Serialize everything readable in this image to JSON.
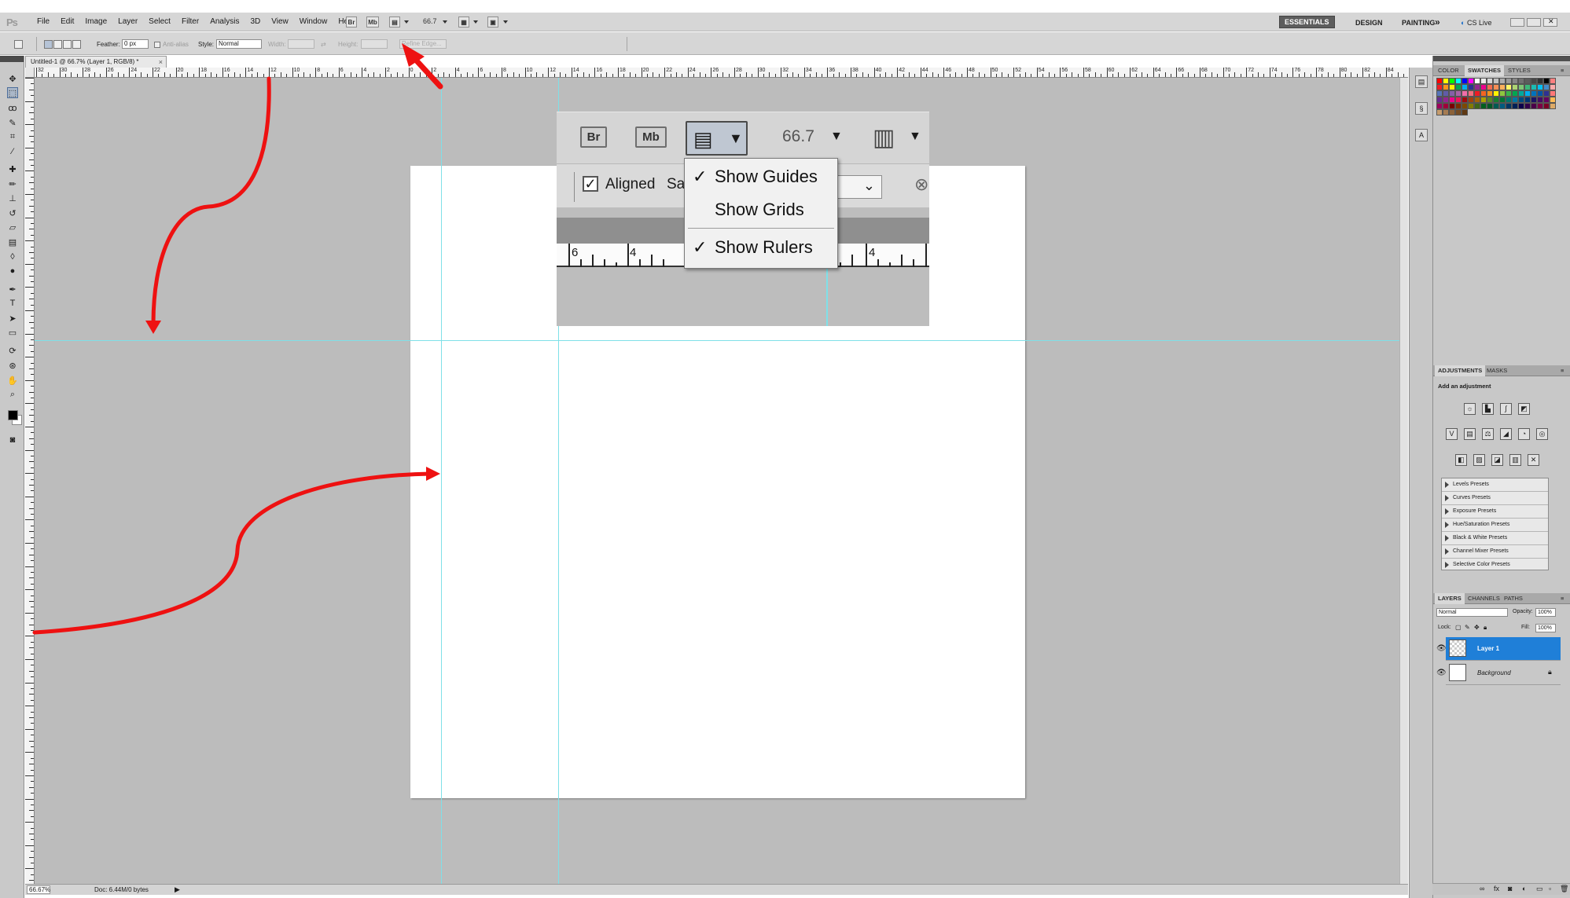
{
  "menubar": {
    "logo": "Ps",
    "items": [
      "File",
      "Edit",
      "Image",
      "Layer",
      "Select",
      "Filter",
      "Analysis",
      "3D",
      "View",
      "Window",
      "Help"
    ],
    "bridge_label": "Br",
    "minibridge_label": "Mb",
    "zoom_value": "66.7",
    "workspaces": [
      "ESSENTIALS",
      "DESIGN",
      "PAINTING"
    ],
    "more_workspaces": "»",
    "cs_live": "CS Live"
  },
  "options": {
    "feather_label": "Feather:",
    "feather_value": "0 px",
    "antialias_label": "Anti-alias",
    "style_label": "Style:",
    "style_value": "Normal",
    "width_label": "Width:",
    "height_label": "Height:",
    "refine_edge_label": "Refine Edge..."
  },
  "document": {
    "tab_title": "Untitled-1 @ 66.7% (Layer 1, RGB/8) *",
    "close_glyph": "×",
    "ruler_numbers": [
      "32",
      "30",
      "28",
      "26",
      "24",
      "22",
      "20",
      "18",
      "16",
      "14",
      "12",
      "10",
      "8",
      "6",
      "4",
      "2",
      "0",
      "2",
      "4",
      "6",
      "8",
      "10",
      "12",
      "14",
      "16",
      "18",
      "20",
      "22",
      "24",
      "26",
      "28",
      "30",
      "32",
      "34",
      "36",
      "38",
      "40",
      "42",
      "44",
      "46",
      "48",
      "50",
      "52",
      "54",
      "56",
      "58",
      "60",
      "62",
      "64",
      "66",
      "68",
      "70",
      "72",
      "74",
      "76",
      "78",
      "80",
      "82",
      "84"
    ]
  },
  "status": {
    "zoom": "66.67%",
    "doc_info": "Doc: 6.44M/0 bytes"
  },
  "inset": {
    "bridge_label": "Br",
    "minibridge_label": "Mb",
    "zoom_value": "66.7",
    "aligned_label": "Aligned",
    "sample_partial": "Sa",
    "ruler_left": [
      "6",
      "4"
    ],
    "ruler_right": "4"
  },
  "view_extras_menu": {
    "items": [
      {
        "label": "Show Guides",
        "checked": true
      },
      {
        "label": "Show Grids",
        "checked": false
      },
      {
        "label": "Show Rulers",
        "checked": true
      }
    ],
    "check_glyph": "✓"
  },
  "panels": {
    "color_tabs": [
      "COLOR",
      "SWATCHES",
      "STYLES"
    ],
    "adjust_tabs": [
      "ADJUSTMENTS",
      "MASKS"
    ],
    "adjust_title": "Add an adjustment",
    "presets": [
      "Levels Presets",
      "Curves Presets",
      "Exposure Presets",
      "Hue/Saturation Presets",
      "Black & White Presets",
      "Channel Mixer Presets",
      "Selective Color Presets"
    ],
    "layer_tabs": [
      "LAYERS",
      "CHANNELS",
      "PATHS"
    ],
    "blend_mode": "Normal",
    "opacity_label": "Opacity:",
    "opacity_value": "100%",
    "lock_label": "Lock:",
    "fill_label": "Fill:",
    "fill_value": "100%",
    "layers": [
      {
        "name": "Layer 1",
        "selected": true
      },
      {
        "name": "Background",
        "selected": false
      }
    ]
  },
  "colors": {
    "annotation_red": "#ee1111",
    "guide_cyan": "#7fe0e8",
    "selection_blue": "#1f7fd8",
    "swatches": [
      "#ff0000",
      "#ffff00",
      "#00ff00",
      "#00ffff",
      "#0000ff",
      "#ff00ff",
      "#ffffff",
      "#ebebeb",
      "#d6d6d6",
      "#c2c2c2",
      "#adadad",
      "#999999",
      "#858585",
      "#707070",
      "#5c5c5c",
      "#474747",
      "#333333",
      "#000000",
      "#ff8080",
      "#ee1d24",
      "#f7941d",
      "#fff200",
      "#00a651",
      "#00aeef",
      "#2e3192",
      "#92278f",
      "#ec008c",
      "#f26c4f",
      "#f68e55",
      "#fbaf5c",
      "#fff467",
      "#acd372",
      "#7cc576",
      "#3bb878",
      "#1abbb4",
      "#00bff3",
      "#438ccb",
      "#ffaaaa",
      "#5574b9",
      "#605ca8",
      "#855fa8",
      "#a763a8",
      "#f06ea9",
      "#f26d7d",
      "#ed1c24",
      "#f26522",
      "#f7941d",
      "#fff200",
      "#8dc63f",
      "#39b54a",
      "#00a651",
      "#00a99d",
      "#00aeef",
      "#0072bc",
      "#0054a6",
      "#2e3192",
      "#ff7777",
      "#662d91",
      "#92278f",
      "#ec008c",
      "#ed145b",
      "#9e0b0f",
      "#a0410d",
      "#a36209",
      "#aba000",
      "#598527",
      "#197b30",
      "#007236",
      "#00746b",
      "#0076a3",
      "#004b80",
      "#003471",
      "#1b1464",
      "#440e62",
      "#630460",
      "#ffbb55",
      "#9e005d",
      "#9e0039",
      "#790000",
      "#7b2e00",
      "#7d4900",
      "#827b00",
      "#406618",
      "#005e20",
      "#005826",
      "#005952",
      "#005b7f",
      "#003663",
      "#002157",
      "#0d004c",
      "#32004b",
      "#4b0049",
      "#7b0046",
      "#7a0026",
      "#ddaa66",
      "#c69c6d",
      "#a67c52",
      "#8c6239",
      "#754c24",
      "#603913"
    ]
  }
}
